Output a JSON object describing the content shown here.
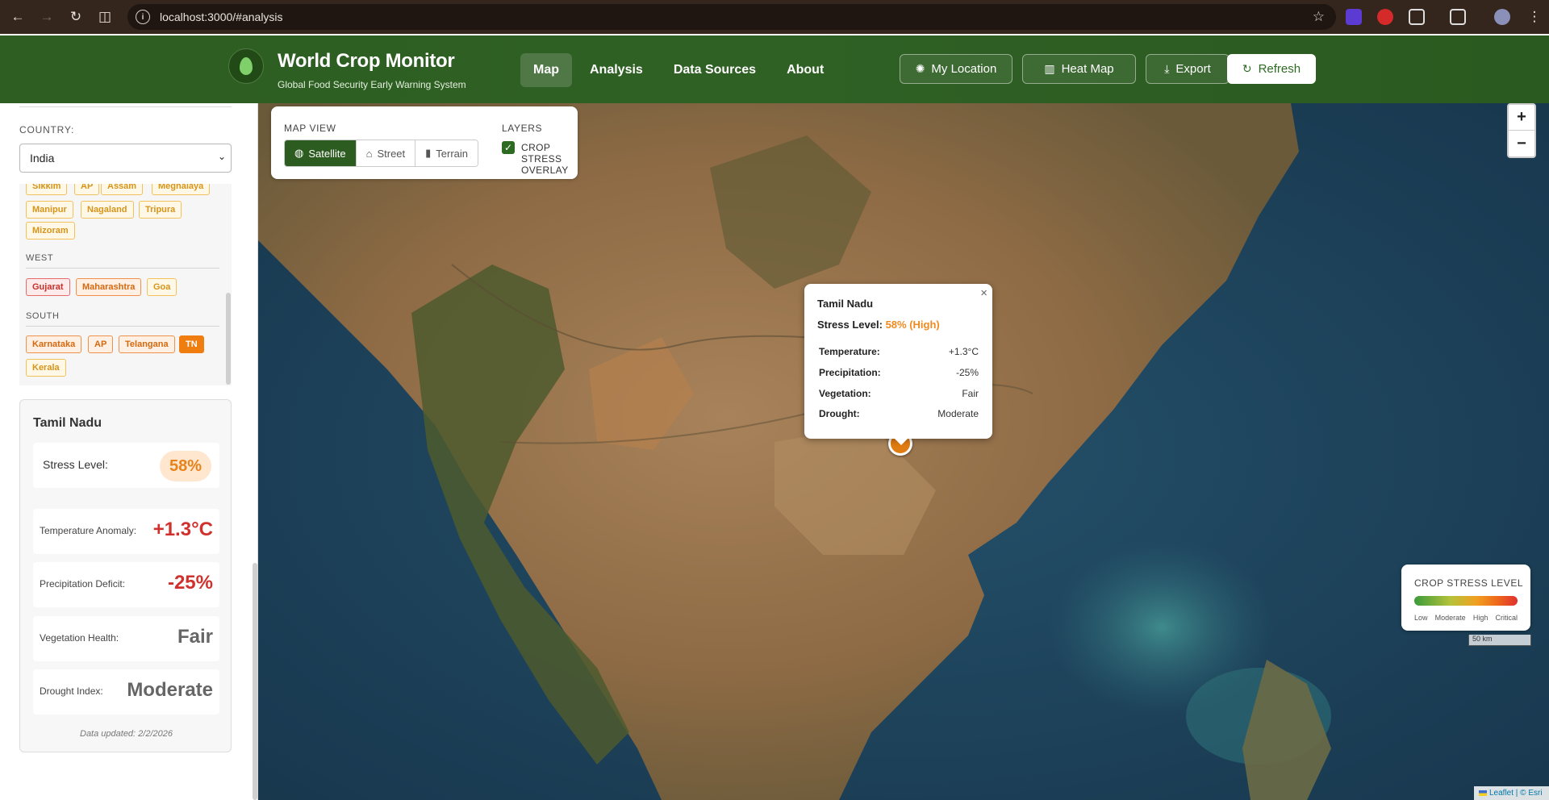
{
  "browser": {
    "url": "localhost:3000/#analysis"
  },
  "header": {
    "title": "World Crop Monitor",
    "subtitle": "Global Food Security Early Warning System",
    "nav": [
      "Map",
      "Analysis",
      "Data Sources",
      "About"
    ],
    "active_nav": "Map",
    "buttons": {
      "location": "My Location",
      "heatmap": "Heat Map",
      "export": "Export",
      "refresh": "Refresh"
    }
  },
  "sidebar": {
    "country_label": "COUNTRY:",
    "country_value": "India",
    "regions": {
      "northeast_chips": [
        "Sikkim",
        "AP",
        "Assam",
        "Meghalaya",
        "Manipur",
        "Nagaland",
        "Tripura",
        "Mizoram"
      ],
      "west_label": "WEST",
      "west_chips": [
        "Gujarat",
        "Maharashtra",
        "Goa"
      ],
      "south_label": "SOUTH",
      "south_chips": [
        "Karnataka",
        "AP",
        "Telangana",
        "TN",
        "Kerala"
      ]
    },
    "detail": {
      "title": "Tamil Nadu",
      "stress_label": "Stress Level:",
      "stress_value": "58%",
      "temp_label": "Temperature Anomaly:",
      "temp_value": "+1.3°C",
      "precip_label": "Precipitation Deficit:",
      "precip_value": "-25%",
      "veg_label": "Vegetation Health:",
      "veg_value": "Fair",
      "drought_label": "Drought Index:",
      "drought_value": "Moderate",
      "updated": "Data updated: 2/2/2026"
    }
  },
  "map": {
    "view_label": "MAP VIEW",
    "views": [
      "Satellite",
      "Street",
      "Terrain"
    ],
    "active_view": "Satellite",
    "layers_label": "LAYERS",
    "layer_overlay": "CROP STRESS OVERLAY",
    "layer_overlay_checked": true,
    "zoom_in": "+",
    "zoom_out": "−",
    "popup": {
      "title": "Tamil Nadu",
      "stress_label": "Stress Level:",
      "stress_value": "58% (High)",
      "rows": [
        {
          "k": "Temperature:",
          "v": "+1.3°C"
        },
        {
          "k": "Precipitation:",
          "v": "-25%"
        },
        {
          "k": "Vegetation:",
          "v": "Fair"
        },
        {
          "k": "Drought:",
          "v": "Moderate"
        }
      ]
    },
    "legend": {
      "title": "CROP STRESS LEVEL",
      "labels": [
        "Low",
        "Moderate",
        "High",
        "Critical"
      ]
    },
    "scale": "50 km",
    "attribution": "Leaflet | © Esri"
  },
  "colors": {
    "brand_green": "#2e5e21",
    "stress_high": "#f08a1e",
    "critical_red": "#d0312d"
  }
}
